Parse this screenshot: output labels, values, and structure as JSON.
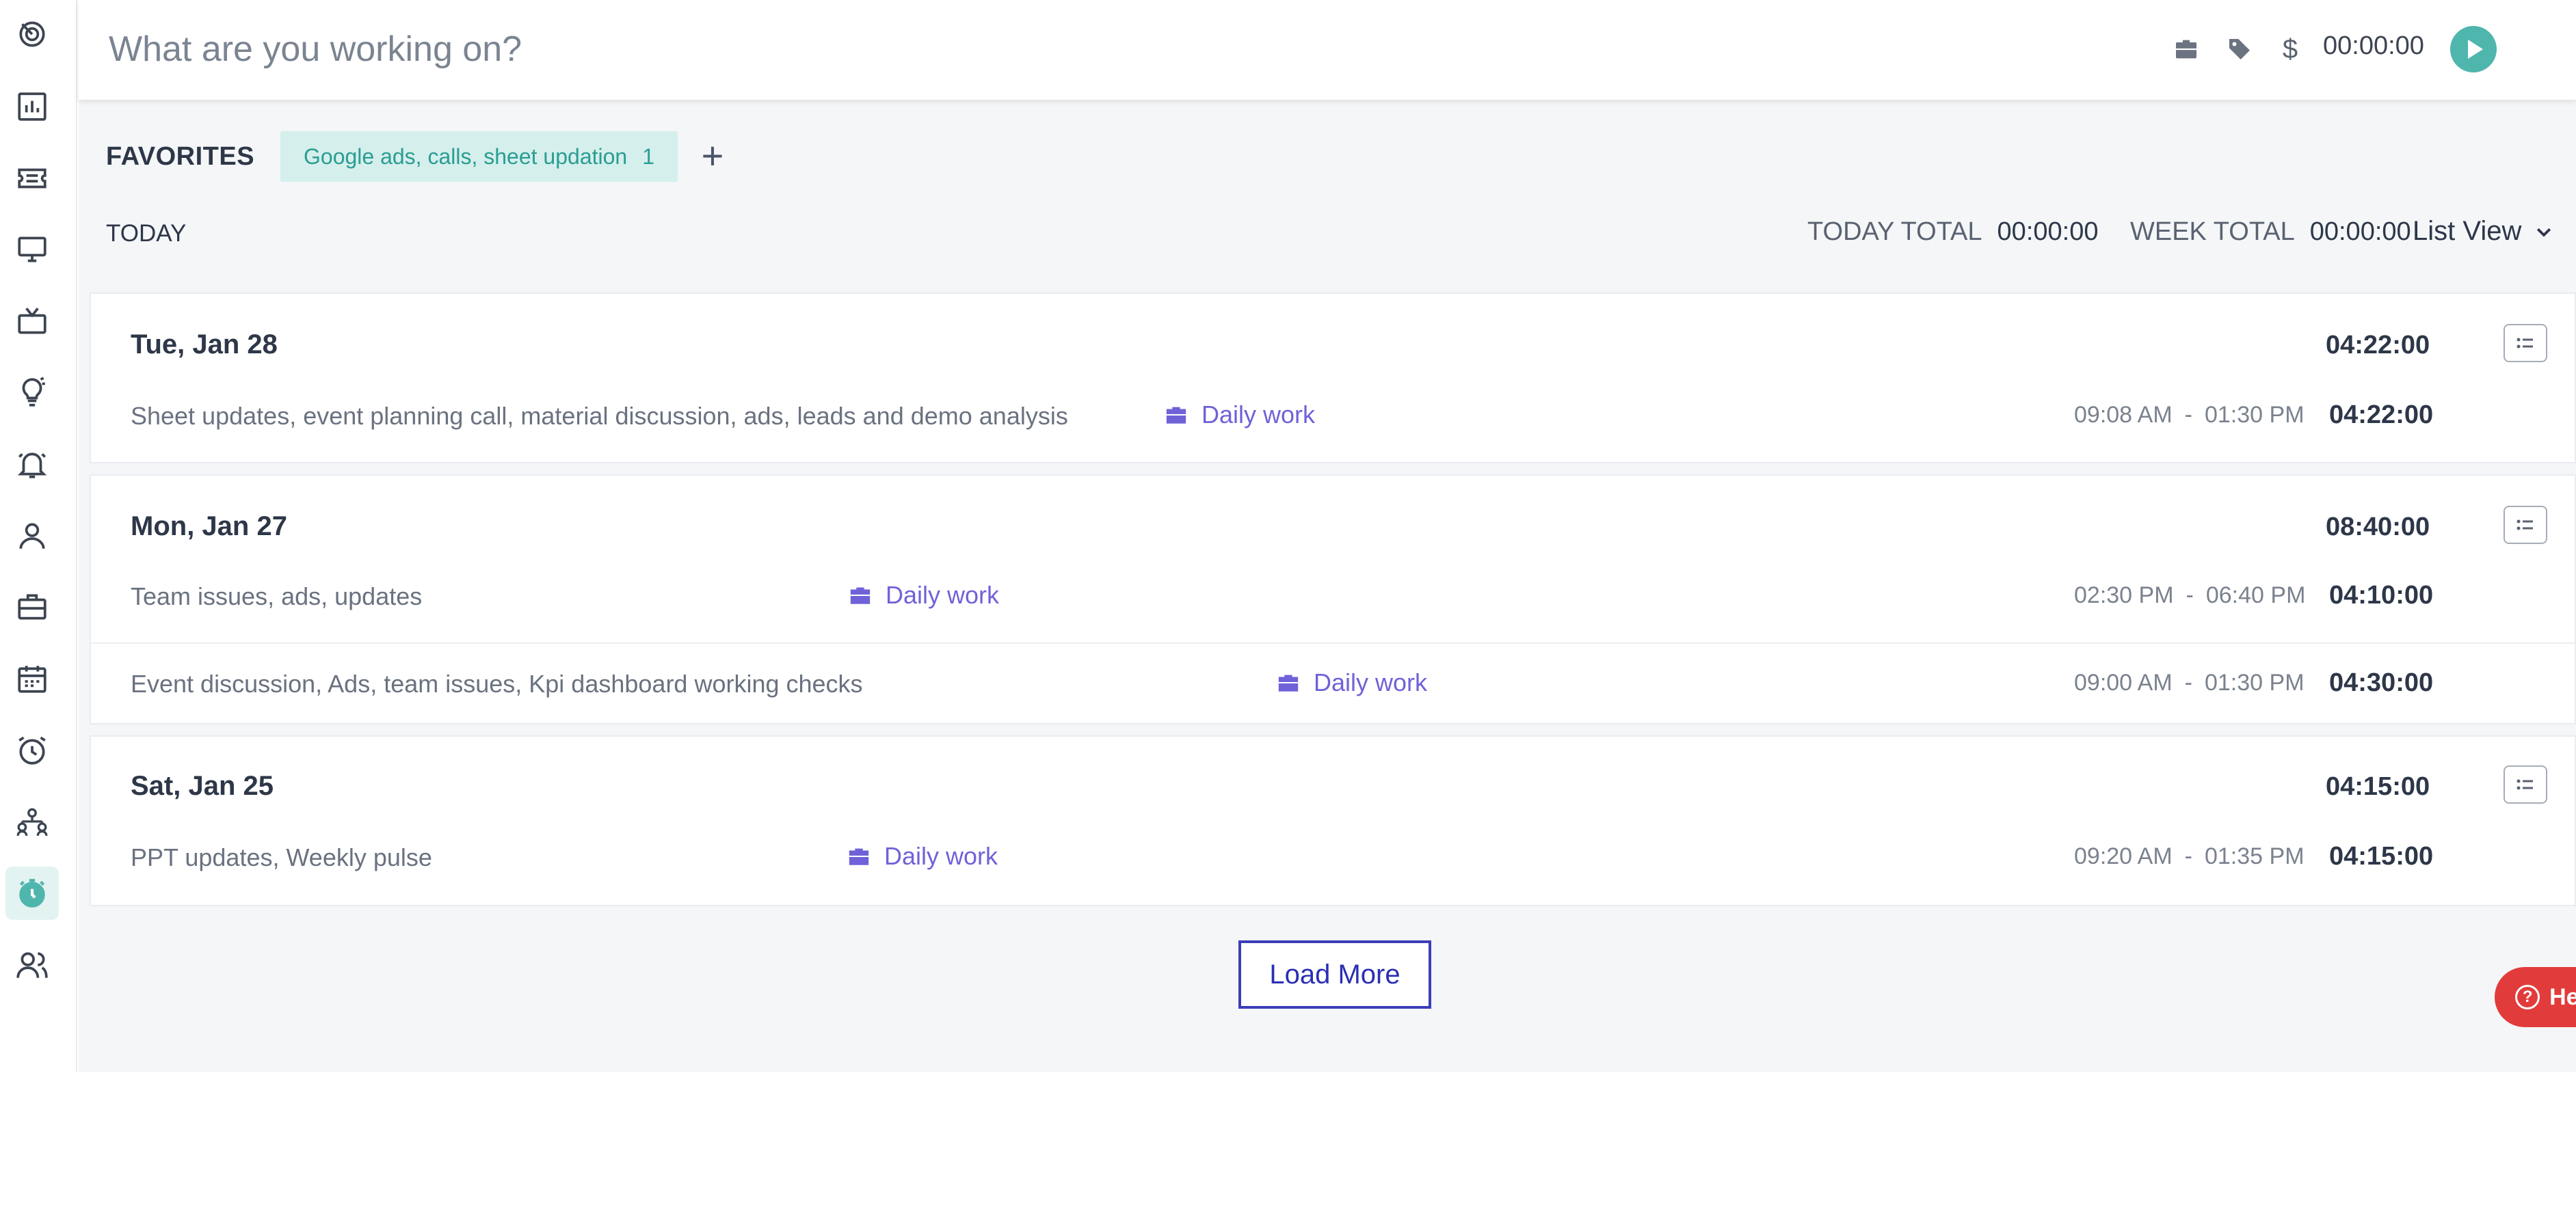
{
  "sidebar": {
    "items": [
      {
        "icon": "logo-icon"
      },
      {
        "icon": "dashboard-chart-icon"
      },
      {
        "icon": "ticket-icon"
      },
      {
        "icon": "monitor-icon"
      },
      {
        "icon": "tv-icon"
      },
      {
        "icon": "lightbulb-icon"
      },
      {
        "icon": "alarm-bell-icon"
      },
      {
        "icon": "user-icon"
      },
      {
        "icon": "briefcase-icon"
      },
      {
        "icon": "calendar-icon"
      },
      {
        "icon": "alarm-clock-icon"
      },
      {
        "icon": "org-chart-icon"
      },
      {
        "icon": "timer-icon",
        "active": true
      },
      {
        "icon": "team-icon"
      }
    ],
    "accent": "#4fb6ad"
  },
  "topbar": {
    "placeholder": "What are you working on?",
    "icons": [
      "project-briefcase-icon",
      "tag-icon",
      "billable-dollar-icon"
    ],
    "dollar": "$",
    "timer": "00:00:00"
  },
  "favorites": {
    "label": "FAVORITES",
    "chip_label": "Google ads, calls, sheet updation",
    "chip_count": "1"
  },
  "summary": {
    "today_label": "TODAY",
    "today_total_label": "TODAY TOTAL",
    "today_total": "00:00:00",
    "week_total_label": "WEEK TOTAL",
    "week_total": "00:00:00",
    "view_label": "List View"
  },
  "days": [
    {
      "date": "Tue, Jan 28",
      "total": "04:22:00",
      "entries": [
        {
          "description": "Sheet updates, event planning call, material discussion, ads, leads and demo analysis",
          "project": "Daily work",
          "start": "09:08 AM",
          "end": "01:30 PM",
          "duration": "04:22:00"
        }
      ]
    },
    {
      "date": "Mon, Jan 27",
      "total": "08:40:00",
      "entries": [
        {
          "description": "Team issues, ads, updates",
          "project": "Daily work",
          "start": "02:30 PM",
          "end": "06:40 PM",
          "duration": "04:10:00"
        },
        {
          "description": "Event discussion, Ads, team issues, Kpi dashboard working checks",
          "project": "Daily work",
          "start": "09:00 AM",
          "end": "01:30 PM",
          "duration": "04:30:00"
        }
      ]
    },
    {
      "date": "Sat, Jan 25",
      "total": "04:15:00",
      "entries": [
        {
          "description": "PPT updates, Weekly pulse",
          "project": "Daily work",
          "start": "09:20 AM",
          "end": "01:35 PM",
          "duration": "04:15:00"
        }
      ]
    }
  ],
  "range_separator": "-",
  "load_more": "Load More",
  "help": {
    "label": "Help",
    "icon": "?"
  },
  "colors": {
    "project": "#6f62d8",
    "help": "#e23b3b",
    "play": "#4fb6ad",
    "load_more": "#3c3eb8"
  }
}
